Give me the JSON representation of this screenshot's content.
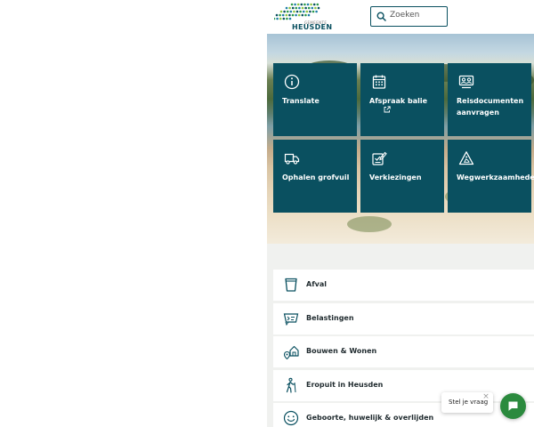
{
  "header": {
    "logo_small": "GEMEENTE",
    "logo_word": "HEUSDEN",
    "search_placeholder": "Zoeken",
    "logo_colors": [
      "#2b9a4a",
      "#1e7fa8",
      "#8dc63f",
      "#0a5060"
    ]
  },
  "tiles": [
    {
      "label": "Translate",
      "icon": "info-icon"
    },
    {
      "label": "Afspraak balie",
      "icon": "calendar-icon",
      "external": true,
      "external_icon": "external-link-icon"
    },
    {
      "label": "Reisdocumenten aanvragen",
      "icon": "id-card-icon"
    },
    {
      "label": "Ophalen grofvuil",
      "icon": "garbage-truck-icon"
    },
    {
      "label": "Verkiezingen",
      "icon": "ballot-icon"
    },
    {
      "label": "Wegwerkzaamheden",
      "icon": "roadwork-sign-icon"
    }
  ],
  "list": [
    {
      "label": "Afval",
      "icon": "waste-bin-icon"
    },
    {
      "label": "Belastingen",
      "icon": "tax-bill-icon"
    },
    {
      "label": "Bouwen & Wonen",
      "icon": "house-location-icon"
    },
    {
      "label": "Eropuit in Heusden",
      "icon": "hiker-icon"
    },
    {
      "label": "Geboorte, huwelijk & overlijden",
      "icon": "smiley-icon"
    }
  ],
  "chat": {
    "prompt": "Stel je vraag",
    "close_symbol": "×"
  },
  "colors": {
    "tile_bg": "#0a5060",
    "accent": "#0a5060",
    "chat_button": "#2b8a3e",
    "page_bg": "#f0f1ef"
  }
}
